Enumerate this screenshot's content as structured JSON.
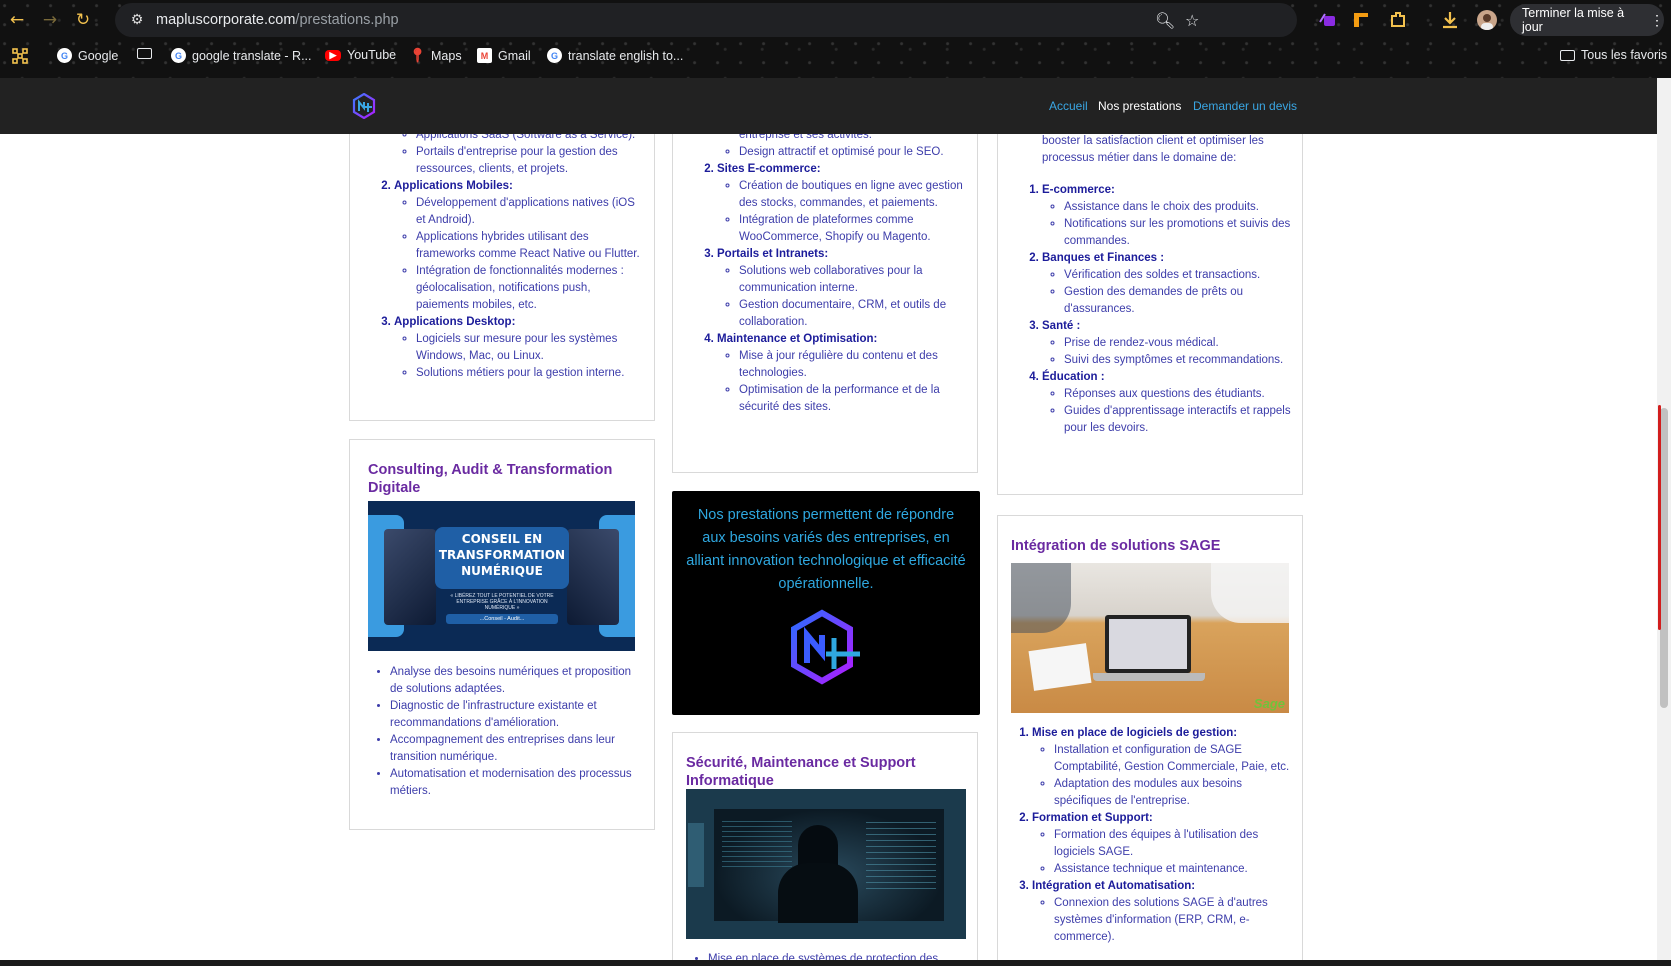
{
  "browser": {
    "url_domain": "mapluscorporate.com",
    "url_path": "/prestations.php",
    "update_button": "Terminer la mise à jour",
    "bookmarks": [
      {
        "label": "Google",
        "icon": "google-icon"
      },
      {
        "label": "",
        "icon": "folder-icon"
      },
      {
        "label": "google translate - R...",
        "icon": "google-icon"
      },
      {
        "label": "YouTube",
        "icon": "youtube-icon"
      },
      {
        "label": "Maps",
        "icon": "maps-pin-icon"
      },
      {
        "label": "Gmail",
        "icon": "gmail-icon"
      },
      {
        "label": "translate english to...",
        "icon": "google-icon"
      }
    ],
    "all_bookmarks": "Tous les favoris"
  },
  "site_nav": {
    "home": "Accueil",
    "services": "Nos prestations",
    "quote": "Demander un devis"
  },
  "col1_top": {
    "partial_item": "Applications SaaS (Software as a Service).",
    "item1_bullet2": "Portails d'entreprise pour la gestion des ressources, clients, et projets.",
    "item2_title": "Applications Mobiles:",
    "item2_bullets": [
      "Développement d'applications natives (iOS et Android).",
      "Applications hybrides utilisant des frameworks comme React Native ou Flutter.",
      "Intégration de fonctionnalités modernes : géolocalisation, notifications push, paiements mobiles, etc."
    ],
    "item3_title": "Applications Desktop:",
    "item3_bullets": [
      "Logiciels sur mesure pour les systèmes Windows, Mac, ou Linux.",
      "Solutions métiers pour la gestion interne."
    ]
  },
  "col2_top": {
    "partial_item": "entreprise et ses activités.",
    "item1_bullet_last": "Design attractif et optimisé pour le SEO.",
    "item2_title": "Sites E-commerce:",
    "item2_bullets": [
      "Création de boutiques en ligne avec gestion des stocks, commandes, et paiements.",
      "Intégration de plateformes comme WooCommerce, Shopify ou Magento."
    ],
    "item3_title": "Portails et Intranets:",
    "item3_bullets": [
      "Solutions web collaboratives pour la communication interne.",
      "Gestion documentaire, CRM, et outils de collaboration."
    ],
    "item4_title": "Maintenance et Optimisation:",
    "item4_bullets": [
      "Mise à jour régulière du contenu et des technologies.",
      "Optimisation de la performance et de la sécurité des sites."
    ]
  },
  "col3_top": {
    "intro": "booster la satisfaction client et optimiser les processus métier dans le domaine de:",
    "item1_title": "E-commerce:",
    "item1_bullets": [
      "Assistance dans le choix des produits.",
      "Notifications sur les promotions et suivis des commandes."
    ],
    "item2_title": "Banques et Finances :",
    "item2_bullets": [
      "Vérification des soldes et transactions.",
      "Gestion des demandes de prêts ou d'assurances."
    ],
    "item3_title": "Santé :",
    "item3_bullets": [
      "Prise de rendez-vous médical.",
      "Suivi des symptômes et recommandations."
    ],
    "item4_title": "Éducation :",
    "item4_bullets": [
      "Réponses aux questions des étudiants.",
      "Guides d'apprentissage interactifs et rappels pour les devoirs."
    ]
  },
  "consulting": {
    "title": "Consulting, Audit & Transformation Digitale",
    "banner_title": "CONSEIL EN TRANSFORMATION NUMÉRIQUE",
    "banner_sub": "« LIBÉREZ TOUT LE POTENTIEL DE VOTRE ENTREPRISE GRÂCE À L'INNOVATION NUMÉRIQUE »",
    "banner_tag": "...Conseil - Audit...",
    "bullets": [
      "Analyse des besoins numériques et proposition de solutions adaptées.",
      "Diagnostic de l'infrastructure existante et recommandations d'amélioration.",
      "Accompagnement des entreprises dans leur transition numérique.",
      "Automatisation et modernisation des processus métiers."
    ]
  },
  "promo": {
    "text": "Nos prestations permettent de répondre aux besoins variés des entreprises, en alliant innovation technologique et efficacité opérationnelle."
  },
  "security": {
    "title": "Sécurité, Maintenance et Support Informatique",
    "partial_bullet": "Mise en place de systèmes de protection des"
  },
  "sage": {
    "title": "Intégration de solutions SAGE",
    "image_brand": "Sage",
    "item1_title": "Mise en place de logiciels de gestion:",
    "item1_bullets": [
      "Installation et configuration de SAGE Comptabilité, Gestion Commerciale, Paie, etc.",
      "Adaptation des modules aux besoins spécifiques de l'entreprise."
    ],
    "item2_title": "Formation et Support:",
    "item2_bullets": [
      "Formation des équipes à l'utilisation des logiciels SAGE.",
      "Assistance technique et maintenance."
    ],
    "item3_title": "Intégration et Automatisation:",
    "item3_bullets": [
      "Connexion des solutions SAGE à d'autres systèmes d'information (ERP, CRM, e-commerce)."
    ]
  }
}
